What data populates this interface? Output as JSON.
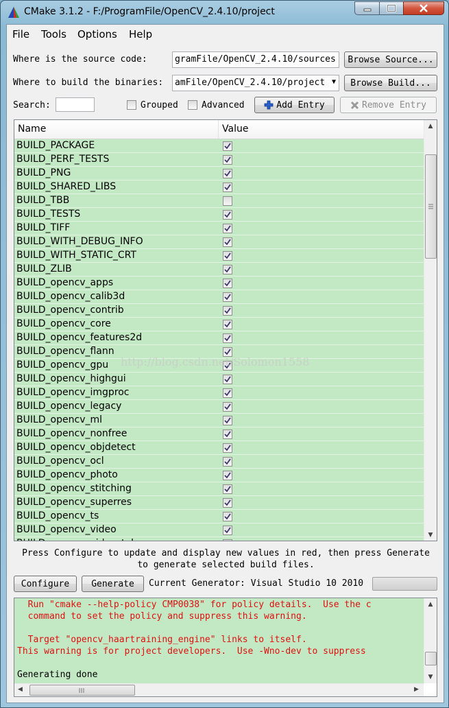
{
  "window": {
    "title": "CMake 3.1.2 - F:/ProgramFile/OpenCV_2.4.10/project"
  },
  "menu": [
    "File",
    "Tools",
    "Options",
    "Help"
  ],
  "source": {
    "label": "Where is the source code:",
    "value": "gramFile/OpenCV_2.4.10/sources",
    "browse_label": "Browse Source..."
  },
  "build": {
    "label": "Where to build the binaries:",
    "value": "amFile/OpenCV_2.4.10/project",
    "browse_label": "Browse Build..."
  },
  "search": {
    "label": "Search:",
    "value": "",
    "grouped_label": "Grouped",
    "grouped_checked": false,
    "advanced_label": "Advanced",
    "advanced_checked": false,
    "add_label": "Add Entry",
    "remove_label": "Remove Entry"
  },
  "table": {
    "columns": [
      "Name",
      "Value"
    ],
    "rows": [
      {
        "name": "BUILD_PACKAGE",
        "checked": true
      },
      {
        "name": "BUILD_PERF_TESTS",
        "checked": true
      },
      {
        "name": "BUILD_PNG",
        "checked": true
      },
      {
        "name": "BUILD_SHARED_LIBS",
        "checked": true
      },
      {
        "name": "BUILD_TBB",
        "checked": false
      },
      {
        "name": "BUILD_TESTS",
        "checked": true
      },
      {
        "name": "BUILD_TIFF",
        "checked": true
      },
      {
        "name": "BUILD_WITH_DEBUG_INFO",
        "checked": true
      },
      {
        "name": "BUILD_WITH_STATIC_CRT",
        "checked": true
      },
      {
        "name": "BUILD_ZLIB",
        "checked": true
      },
      {
        "name": "BUILD_opencv_apps",
        "checked": true
      },
      {
        "name": "BUILD_opencv_calib3d",
        "checked": true
      },
      {
        "name": "BUILD_opencv_contrib",
        "checked": true
      },
      {
        "name": "BUILD_opencv_core",
        "checked": true
      },
      {
        "name": "BUILD_opencv_features2d",
        "checked": true
      },
      {
        "name": "BUILD_opencv_flann",
        "checked": true
      },
      {
        "name": "BUILD_opencv_gpu",
        "checked": true
      },
      {
        "name": "BUILD_opencv_highgui",
        "checked": true
      },
      {
        "name": "BUILD_opencv_imgproc",
        "checked": true
      },
      {
        "name": "BUILD_opencv_legacy",
        "checked": true
      },
      {
        "name": "BUILD_opencv_ml",
        "checked": true
      },
      {
        "name": "BUILD_opencv_nonfree",
        "checked": true
      },
      {
        "name": "BUILD_opencv_objdetect",
        "checked": true
      },
      {
        "name": "BUILD_opencv_ocl",
        "checked": true
      },
      {
        "name": "BUILD_opencv_photo",
        "checked": true
      },
      {
        "name": "BUILD_opencv_stitching",
        "checked": true
      },
      {
        "name": "BUILD_opencv_superres",
        "checked": true
      },
      {
        "name": "BUILD_opencv_ts",
        "checked": true
      },
      {
        "name": "BUILD_opencv_video",
        "checked": true
      },
      {
        "name": "BUILD_opencv_videostab",
        "checked": true
      }
    ]
  },
  "watermark": "http://blog.csdn.net/Solomon1558",
  "hint": {
    "line1": "Press Configure to update and display new values in red, then press Generate",
    "line2": "to generate selected build files."
  },
  "actions": {
    "configure_label": "Configure",
    "generate_label": "Generate",
    "generator_text": "Current Generator: Visual Studio 10 2010"
  },
  "output": {
    "lines": [
      {
        "text": "  Run \"cmake --help-policy CMP0038\" for policy details.  Use the c",
        "color": "red"
      },
      {
        "text": "  command to set the policy and suppress this warning.",
        "color": "red"
      },
      {
        "text": "",
        "color": "red"
      },
      {
        "text": "  Target \"opencv_haartraining_engine\" links to itself.",
        "color": "red"
      },
      {
        "text": "This warning is for project developers.  Use -Wno-dev to suppress",
        "color": "red"
      },
      {
        "text": "",
        "color": "black"
      },
      {
        "text": "Generating done",
        "color": "black"
      }
    ]
  }
}
